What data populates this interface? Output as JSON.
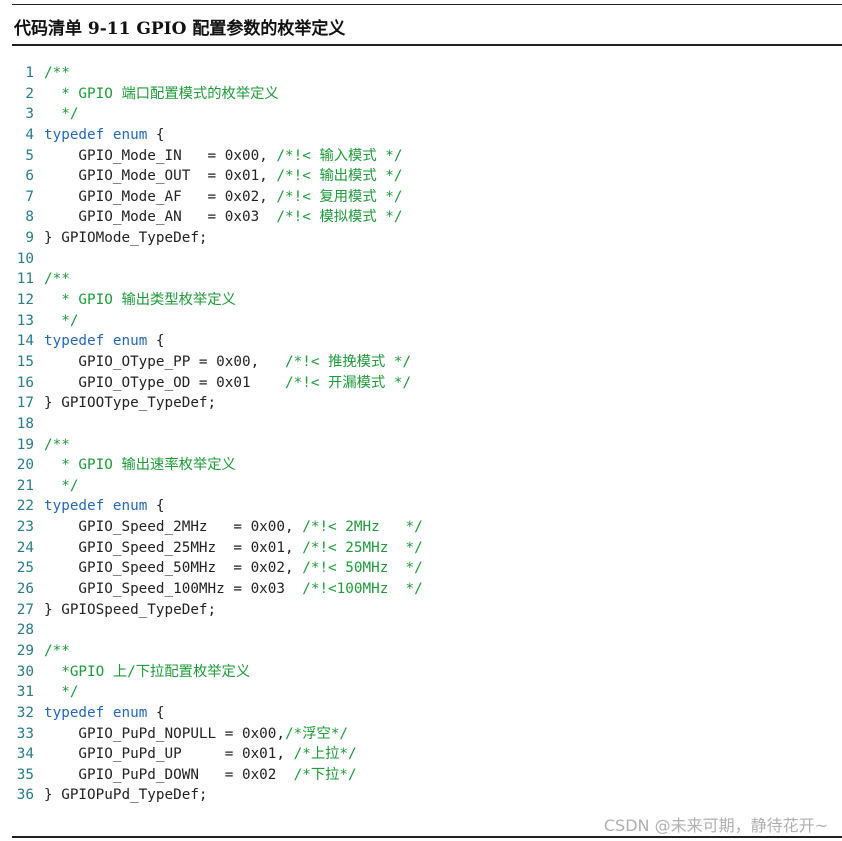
{
  "listing_title": "代码清单 9-11 GPIO 配置参数的枚举定义",
  "watermark": "CSDN @未来可期，静待花开~",
  "colors": {
    "keyword": "#2468b6",
    "comment": "#1f9a3a",
    "line_number": "#2a7a8c",
    "text": "#222222"
  },
  "lines": [
    {
      "n": "1",
      "parts": [
        {
          "t": "/**",
          "k": "cm"
        }
      ]
    },
    {
      "n": "2",
      "parts": [
        {
          "t": "  * GPIO 端口配置模式的枚举定义",
          "k": "cm"
        }
      ]
    },
    {
      "n": "3",
      "parts": [
        {
          "t": "  */",
          "k": "cm"
        }
      ]
    },
    {
      "n": "4",
      "parts": [
        {
          "t": "typedef",
          "k": "kw"
        },
        {
          "t": " ",
          "k": "tx"
        },
        {
          "t": "enum",
          "k": "kw"
        },
        {
          "t": " {",
          "k": "tx"
        }
      ]
    },
    {
      "n": "5",
      "parts": [
        {
          "t": "    GPIO_Mode_IN   = 0x00, ",
          "k": "tx"
        },
        {
          "t": "/*!< 输入模式 */",
          "k": "cm"
        }
      ]
    },
    {
      "n": "6",
      "parts": [
        {
          "t": "    GPIO_Mode_OUT  = 0x01, ",
          "k": "tx"
        },
        {
          "t": "/*!< 输出模式 */",
          "k": "cm"
        }
      ]
    },
    {
      "n": "7",
      "parts": [
        {
          "t": "    GPIO_Mode_AF   = 0x02, ",
          "k": "tx"
        },
        {
          "t": "/*!< 复用模式 */",
          "k": "cm"
        }
      ]
    },
    {
      "n": "8",
      "parts": [
        {
          "t": "    GPIO_Mode_AN   = 0x03  ",
          "k": "tx"
        },
        {
          "t": "/*!< 模拟模式 */",
          "k": "cm"
        }
      ]
    },
    {
      "n": "9",
      "parts": [
        {
          "t": "} GPIOMode_TypeDef;",
          "k": "tx"
        }
      ]
    },
    {
      "n": "10",
      "parts": []
    },
    {
      "n": "11",
      "parts": [
        {
          "t": "/**",
          "k": "cm"
        }
      ]
    },
    {
      "n": "12",
      "parts": [
        {
          "t": "  * GPIO 输出类型枚举定义",
          "k": "cm"
        }
      ]
    },
    {
      "n": "13",
      "parts": [
        {
          "t": "  */",
          "k": "cm"
        }
      ]
    },
    {
      "n": "14",
      "parts": [
        {
          "t": "typedef",
          "k": "kw"
        },
        {
          "t": " ",
          "k": "tx"
        },
        {
          "t": "enum",
          "k": "kw"
        },
        {
          "t": " {",
          "k": "tx"
        }
      ]
    },
    {
      "n": "15",
      "parts": [
        {
          "t": "    GPIO_OType_PP = 0x00,   ",
          "k": "tx"
        },
        {
          "t": "/*!< 推挽模式 */",
          "k": "cm"
        }
      ]
    },
    {
      "n": "16",
      "parts": [
        {
          "t": "    GPIO_OType_OD = 0x01    ",
          "k": "tx"
        },
        {
          "t": "/*!< 开漏模式 */",
          "k": "cm"
        }
      ]
    },
    {
      "n": "17",
      "parts": [
        {
          "t": "} GPIOOType_TypeDef;",
          "k": "tx"
        }
      ]
    },
    {
      "n": "18",
      "parts": []
    },
    {
      "n": "19",
      "parts": [
        {
          "t": "/**",
          "k": "cm"
        }
      ]
    },
    {
      "n": "20",
      "parts": [
        {
          "t": "  * GPIO 输出速率枚举定义",
          "k": "cm"
        }
      ]
    },
    {
      "n": "21",
      "parts": [
        {
          "t": "  */",
          "k": "cm"
        }
      ]
    },
    {
      "n": "22",
      "parts": [
        {
          "t": "typedef",
          "k": "kw"
        },
        {
          "t": " ",
          "k": "tx"
        },
        {
          "t": "enum",
          "k": "kw"
        },
        {
          "t": " {",
          "k": "tx"
        }
      ]
    },
    {
      "n": "23",
      "parts": [
        {
          "t": "    GPIO_Speed_2MHz   = 0x00, ",
          "k": "tx"
        },
        {
          "t": "/*!< 2MHz   */",
          "k": "cm"
        }
      ]
    },
    {
      "n": "24",
      "parts": [
        {
          "t": "    GPIO_Speed_25MHz  = 0x01, ",
          "k": "tx"
        },
        {
          "t": "/*!< 25MHz  */",
          "k": "cm"
        }
      ]
    },
    {
      "n": "25",
      "parts": [
        {
          "t": "    GPIO_Speed_50MHz  = 0x02, ",
          "k": "tx"
        },
        {
          "t": "/*!< 50MHz  */",
          "k": "cm"
        }
      ]
    },
    {
      "n": "26",
      "parts": [
        {
          "t": "    GPIO_Speed_100MHz = 0x03  ",
          "k": "tx"
        },
        {
          "t": "/*!<100MHz  */",
          "k": "cm"
        }
      ]
    },
    {
      "n": "27",
      "parts": [
        {
          "t": "} GPIOSpeed_TypeDef;",
          "k": "tx"
        }
      ]
    },
    {
      "n": "28",
      "parts": []
    },
    {
      "n": "29",
      "parts": [
        {
          "t": "/**",
          "k": "cm"
        }
      ]
    },
    {
      "n": "30",
      "parts": [
        {
          "t": "  *GPIO 上/下拉配置枚举定义",
          "k": "cm"
        }
      ]
    },
    {
      "n": "31",
      "parts": [
        {
          "t": "  */",
          "k": "cm"
        }
      ]
    },
    {
      "n": "32",
      "parts": [
        {
          "t": "typedef",
          "k": "kw"
        },
        {
          "t": " ",
          "k": "tx"
        },
        {
          "t": "enum",
          "k": "kw"
        },
        {
          "t": " {",
          "k": "tx"
        }
      ]
    },
    {
      "n": "33",
      "parts": [
        {
          "t": "    GPIO_PuPd_NOPULL = 0x00,",
          "k": "tx"
        },
        {
          "t": "/*浮空*/",
          "k": "cm"
        }
      ]
    },
    {
      "n": "34",
      "parts": [
        {
          "t": "    GPIO_PuPd_UP     = 0x01, ",
          "k": "tx"
        },
        {
          "t": "/*上拉*/",
          "k": "cm"
        }
      ]
    },
    {
      "n": "35",
      "parts": [
        {
          "t": "    GPIO_PuPd_DOWN   = 0x02  ",
          "k": "tx"
        },
        {
          "t": "/*下拉*/",
          "k": "cm"
        }
      ]
    },
    {
      "n": "36",
      "parts": [
        {
          "t": "} GPIOPuPd_TypeDef;",
          "k": "tx"
        }
      ]
    }
  ]
}
